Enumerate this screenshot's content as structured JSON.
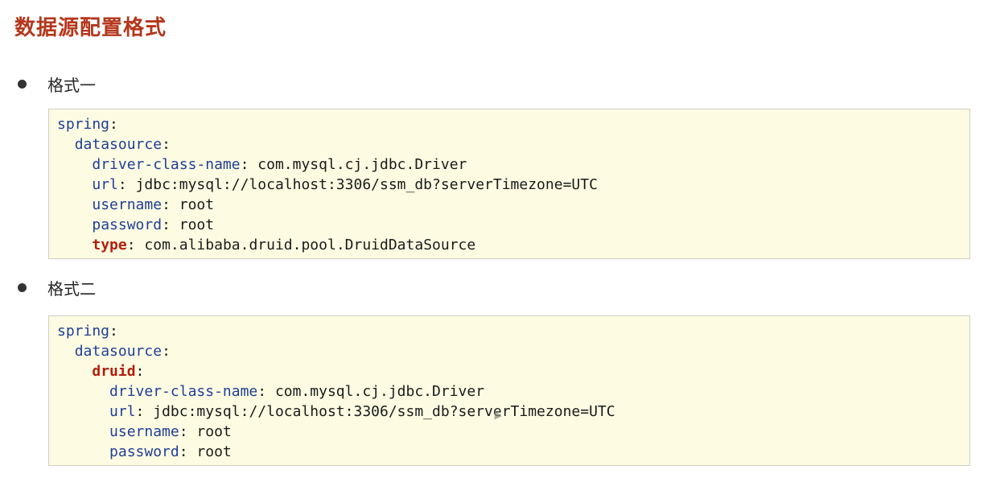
{
  "title": "数据源配置格式",
  "section1": {
    "label": "格式一",
    "lines": [
      {
        "key": "spring",
        "sep": ":",
        "value": ""
      },
      {
        "key": "datasource",
        "sep": ":",
        "value": ""
      },
      {
        "key": "driver-class-name",
        "sep": ": ",
        "value": "com.mysql.cj.jdbc.Driver"
      },
      {
        "key": "url",
        "sep": ": ",
        "value": "jdbc:mysql://localhost:3306/ssm_db?serverTimezone=UTC"
      },
      {
        "key": "username",
        "sep": ": ",
        "value": "root"
      },
      {
        "key": "password",
        "sep": ": ",
        "value": "root"
      },
      {
        "key": "type",
        "sep": ": ",
        "value": "com.alibaba.druid.pool.DruidDataSource"
      }
    ]
  },
  "section2": {
    "label": "格式二",
    "lines": [
      {
        "key": "spring",
        "sep": ":",
        "value": ""
      },
      {
        "key": "datasource",
        "sep": ":",
        "value": ""
      },
      {
        "key": "druid",
        "sep": ":",
        "value": ""
      },
      {
        "key": "driver-class-name",
        "sep": ": ",
        "value": "com.mysql.cj.jdbc.Driver"
      },
      {
        "key": "url",
        "sep": ": ",
        "value": "jdbc:mysql://localhost:3306/ssm_db?serverTimezone=UTC"
      },
      {
        "key": "username",
        "sep": ": ",
        "value": "root"
      },
      {
        "key": "password",
        "sep": ": ",
        "value": "root"
      }
    ]
  }
}
